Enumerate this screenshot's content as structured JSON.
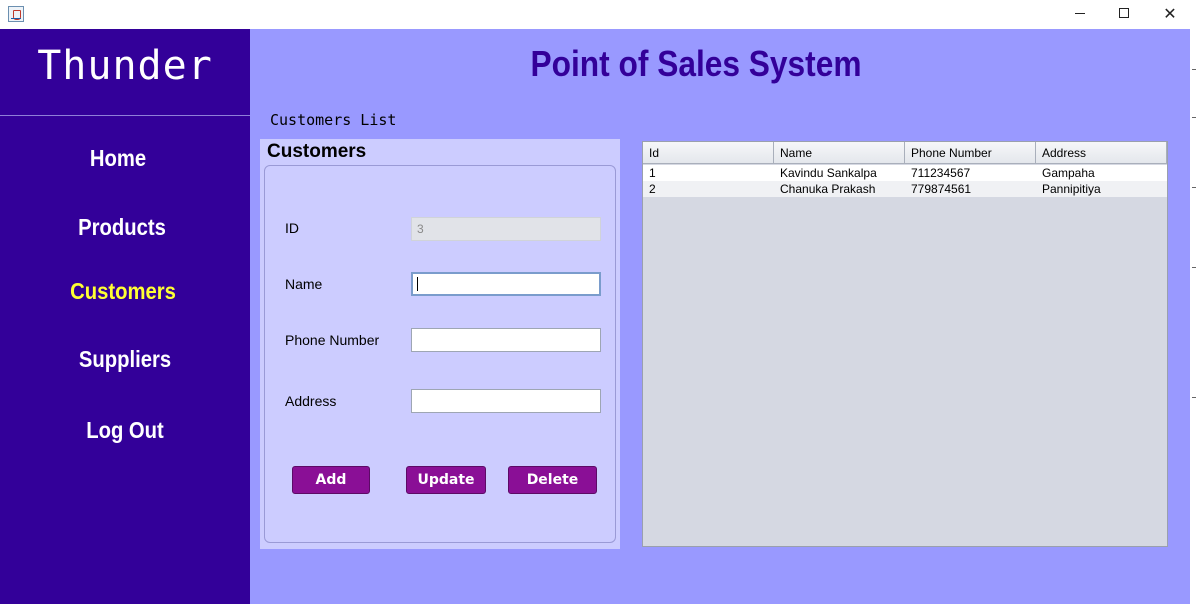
{
  "window": {
    "icon": "java-cup-icon",
    "controls": {
      "minimize": "minimize-icon",
      "maximize": "maximize-icon",
      "close": "✕"
    }
  },
  "sidebar": {
    "brand": "Thunder",
    "items": [
      {
        "label": "Home",
        "active": false
      },
      {
        "label": "Products",
        "active": false
      },
      {
        "label": "Customers",
        "active": true
      },
      {
        "label": "Suppliers",
        "active": false
      },
      {
        "label": "Log Out",
        "active": false
      }
    ]
  },
  "header": {
    "title": "Point of Sales System"
  },
  "section_label": "Customers List",
  "form": {
    "title": "Customers",
    "fields": {
      "id": {
        "label": "ID",
        "value": "3"
      },
      "name": {
        "label": "Name",
        "value": ""
      },
      "phone": {
        "label": "Phone Number",
        "value": ""
      },
      "address": {
        "label": "Address",
        "value": ""
      }
    },
    "buttons": {
      "add": "Add",
      "update": "Update",
      "delete": "Delete"
    }
  },
  "table": {
    "columns": [
      "Id",
      "Name",
      "Phone Number",
      "Address"
    ],
    "rows": [
      [
        "1",
        "Kavindu Sankalpa",
        "711234567",
        "Gampaha"
      ],
      [
        "2",
        "Chanuka Prakash",
        "779874561",
        "Pannipitiya"
      ]
    ]
  },
  "colors": {
    "sidebar_bg": "#330099",
    "main_bg": "#9999ff",
    "panel_bg": "#ccccff",
    "accent_text": "#330099",
    "active_nav": "#ffff33",
    "button_bg": "#8a0f96"
  }
}
